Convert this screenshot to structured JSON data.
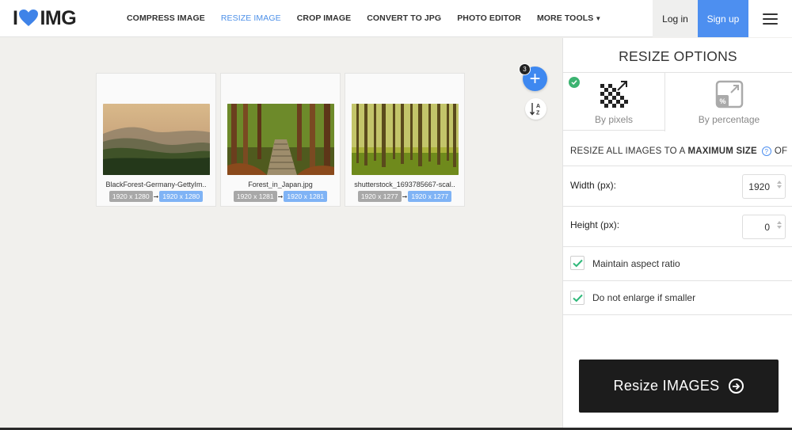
{
  "brand": {
    "logo_left": "I",
    "logo_right": "IMG",
    "accent": "#4d8ff0"
  },
  "nav": {
    "items": [
      {
        "label": "COMPRESS IMAGE"
      },
      {
        "label": "RESIZE IMAGE"
      },
      {
        "label": "CROP IMAGE"
      },
      {
        "label": "CONVERT TO JPG"
      },
      {
        "label": "PHOTO EDITOR"
      },
      {
        "label": "MORE TOOLS"
      }
    ],
    "active": "RESIZE IMAGE",
    "login_label": "Log in",
    "signup_label": "Sign up"
  },
  "workspace": {
    "file_count": "3",
    "files": [
      {
        "name": "BlackForest-Germany-GettyIm..",
        "original": "1920 x 1280",
        "resized": "1920 x 1280"
      },
      {
        "name": "Forest_in_Japan.jpg",
        "original": "1920 x 1281",
        "resized": "1920 x 1281"
      },
      {
        "name": "shutterstock_1693785667-scal..",
        "original": "1920 x 1277",
        "resized": "1920 x 1277"
      }
    ],
    "sort_icon": "sort-alpha-icon",
    "add_icon": "plus-icon"
  },
  "sidebar": {
    "title": "RESIZE OPTIONS",
    "tabs": [
      {
        "label": "By pixels",
        "selected": true
      },
      {
        "label": "By percentage",
        "selected": false
      }
    ],
    "resize_all_prefix": "RESIZE ALL IMAGES TO A",
    "resize_all_bold": "MAXIMUM SIZE",
    "resize_all_suffix": "OF",
    "width_label": "Width (px):",
    "width_value": "1920",
    "height_label": "Height (px):",
    "height_value": "0",
    "maintain_aspect_label": "Maintain aspect ratio",
    "maintain_aspect_checked": true,
    "no_enlarge_label": "Do not enlarge if smaller",
    "no_enlarge_checked": true,
    "submit_label": "Resize IMAGES"
  }
}
